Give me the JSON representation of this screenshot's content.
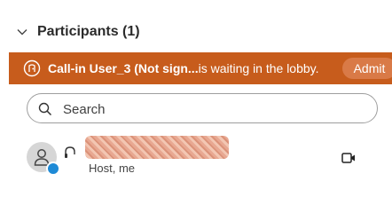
{
  "panel": {
    "title": "Participants (1)"
  },
  "lobby_banner": {
    "name": "Call-in User_3 (Not sign",
    "ellipsis": "...",
    "message_suffix": "is waiting in the lobby.",
    "admit_label": "Admit",
    "background_color": "#c75c1c"
  },
  "search": {
    "placeholder": "Search",
    "value": ""
  },
  "participants": [
    {
      "name": "",
      "name_redacted": true,
      "role": "Host, me",
      "avatar_icon": "person-icon",
      "audio_icon": "headset-icon",
      "video_icon": "video-camera-icon"
    }
  ]
}
